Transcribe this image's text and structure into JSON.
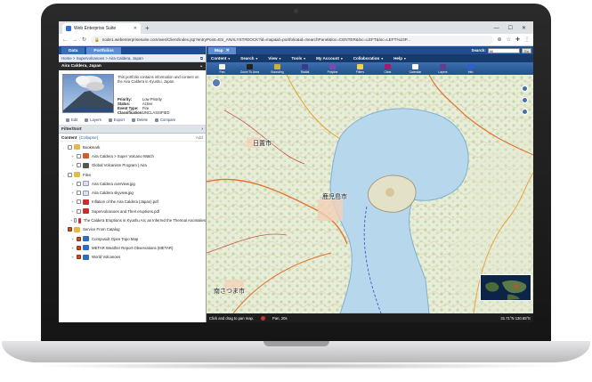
{
  "browser": {
    "tab_title": "Web Enterprise Suite",
    "url": "node1.webenterprisesuite.com/wes/Client/index.jsp?entryPoint=ES_ANALYST#DOCK?id=map&id=portfolio&id=SearchPanel&loc=CENTER&loc=LEFT&loc=LEFT%23P..."
  },
  "left_panel": {
    "tabs": [
      "Data",
      "Portfolios"
    ],
    "breadcrumb": "Home > Supervolcanoes > Aira Caldera, Japan",
    "portfolio_title": "Aira Caldera, Japan",
    "description": "This portfolio contains information and content on the Aira Caldera in Kyushu, Japan.",
    "meta": [
      {
        "key": "Priority:",
        "value": "Low Priority"
      },
      {
        "key": "Status:",
        "value": "Active"
      },
      {
        "key": "Event Type:",
        "value": "Fire"
      },
      {
        "key": "Classification:",
        "value": "UNCLASSIFIED"
      }
    ],
    "actions": [
      "Edit",
      "Layers",
      "Export",
      "Delete",
      "Compare"
    ],
    "filter_label": "Filter/Sort",
    "content_label": "Content",
    "collapse_label": "[Collapse]",
    "add_label": "Add",
    "tree": [
      {
        "label": "Bookmark",
        "indent": 0,
        "icon": "folder",
        "checked": false,
        "expander": "-"
      },
      {
        "label": "Aira Caldera > Super Volcano Watch",
        "indent": 1,
        "icon": "bm",
        "checked": false,
        "expander": "+"
      },
      {
        "label": "Global Volcanism Program | Aira",
        "indent": 1,
        "icon": "gvp",
        "checked": false,
        "expander": "+"
      },
      {
        "label": "Files",
        "indent": 0,
        "icon": "folder",
        "checked": false,
        "expander": "-"
      },
      {
        "label": "Aira Caldera overview.jpg",
        "indent": 1,
        "icon": "doc",
        "checked": false,
        "expander": "+"
      },
      {
        "label": "Aira Caldera skyview.jpg",
        "indent": 1,
        "icon": "doc",
        "checked": false,
        "expander": "+"
      },
      {
        "label": "Inflation of the Aira Caldera (Japan).pdf",
        "indent": 1,
        "icon": "pdf",
        "checked": false,
        "expander": "+"
      },
      {
        "label": "Supervolcanoes and Their eruptions.pdf",
        "indent": 1,
        "icon": "pdf",
        "checked": false,
        "expander": "+"
      },
      {
        "label": "The Caldera Eruptions in Kyushu Arc as Inferred the Thermal Anomalies",
        "indent": 1,
        "icon": "pdf",
        "checked": false,
        "expander": "+"
      },
      {
        "label": "Service From Catalog",
        "indent": 0,
        "icon": "folder",
        "checked": true,
        "expander": "-"
      },
      {
        "label": "Compusult Open Topo Map",
        "indent": 1,
        "icon": "svc",
        "checked": true,
        "expander": "+"
      },
      {
        "label": "METAR Weather Report Observations (METAR)",
        "indent": 1,
        "icon": "svc",
        "checked": true,
        "expander": "+"
      },
      {
        "label": "World Volcanoes",
        "indent": 1,
        "icon": "svc",
        "checked": true,
        "expander": "+"
      }
    ]
  },
  "map_panel": {
    "tab_label": "Map",
    "search_label": "Search:",
    "search_scope": "All",
    "go_label": "Go",
    "menu": [
      "Content",
      "Search",
      "View",
      "Tools",
      "My Account",
      "Collaboration",
      "Help"
    ],
    "tools": [
      {
        "label": "Pan",
        "color": "#f2f2f2"
      },
      {
        "label": "Zoom To Area",
        "color": "#222222"
      },
      {
        "label": "Bounding",
        "color": "#c9b23a"
      },
      {
        "label": "Radial",
        "color": "#3b3b8e"
      },
      {
        "label": "Polyline",
        "color": "#7a4bb0"
      },
      {
        "label": "Filters",
        "color": "#f0d250"
      },
      {
        "label": "Clear",
        "color": "#a01e6a"
      },
      {
        "label": "Calendar",
        "color": "#ffffff"
      },
      {
        "label": "Layers",
        "color": "#6a3b8c"
      },
      {
        "label": "Info",
        "color": "#2a62c9"
      }
    ],
    "map_labels": [
      "日置市",
      "鹿児島市",
      "南さつま市"
    ],
    "status_left": "Click and drag to pan map.",
    "status_mid": "Pan, 20s",
    "status_right": "31.71°N 130.65°E"
  },
  "colors": {
    "app_blue": "#1f4e8c",
    "water": "#b6d7ec",
    "land": "#e7ead4"
  }
}
